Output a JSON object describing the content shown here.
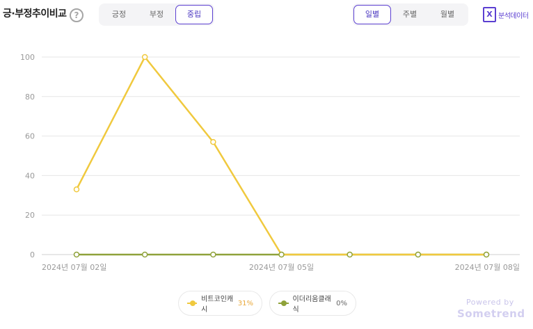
{
  "header": {
    "title": "긍·부정추이비교",
    "help_icon": "?",
    "sentiment_tabs": [
      "긍정",
      "부정",
      "중립"
    ],
    "sentiment_active": 2,
    "period_tabs": [
      "일별",
      "주별",
      "월별"
    ],
    "period_active": 0,
    "export_icon_glyph": "X",
    "export_label": "분석데이터"
  },
  "chart_data": {
    "type": "line",
    "x": [
      "2024-07-02",
      "2024-07-03",
      "2024-07-04",
      "2024-07-05",
      "2024-07-06",
      "2024-07-07",
      "2024-07-08"
    ],
    "x_tick_labels": [
      {
        "index": 0,
        "label": "2024년 07월 02일"
      },
      {
        "index": 3,
        "label": "2024년 07월 05일"
      },
      {
        "index": 6,
        "label": "2024년 07월 08일"
      }
    ],
    "ylim": [
      0,
      100
    ],
    "yticks": [
      0,
      20,
      40,
      60,
      80,
      100
    ],
    "grid": true,
    "series": [
      {
        "name": "비트코인캐시",
        "share": "31%",
        "color": "#f0c93e",
        "pct_color": "#e9a83a",
        "values": [
          33,
          100,
          57,
          0,
          0,
          0,
          0
        ]
      },
      {
        "name": "이더리움클래식",
        "share": "0%",
        "color": "#8fa23a",
        "pct_color": "#666666",
        "values": [
          0,
          0,
          0,
          0,
          0,
          0,
          0
        ]
      }
    ]
  },
  "footer": {
    "powered": "Powered by",
    "brand": "Sometrend"
  }
}
